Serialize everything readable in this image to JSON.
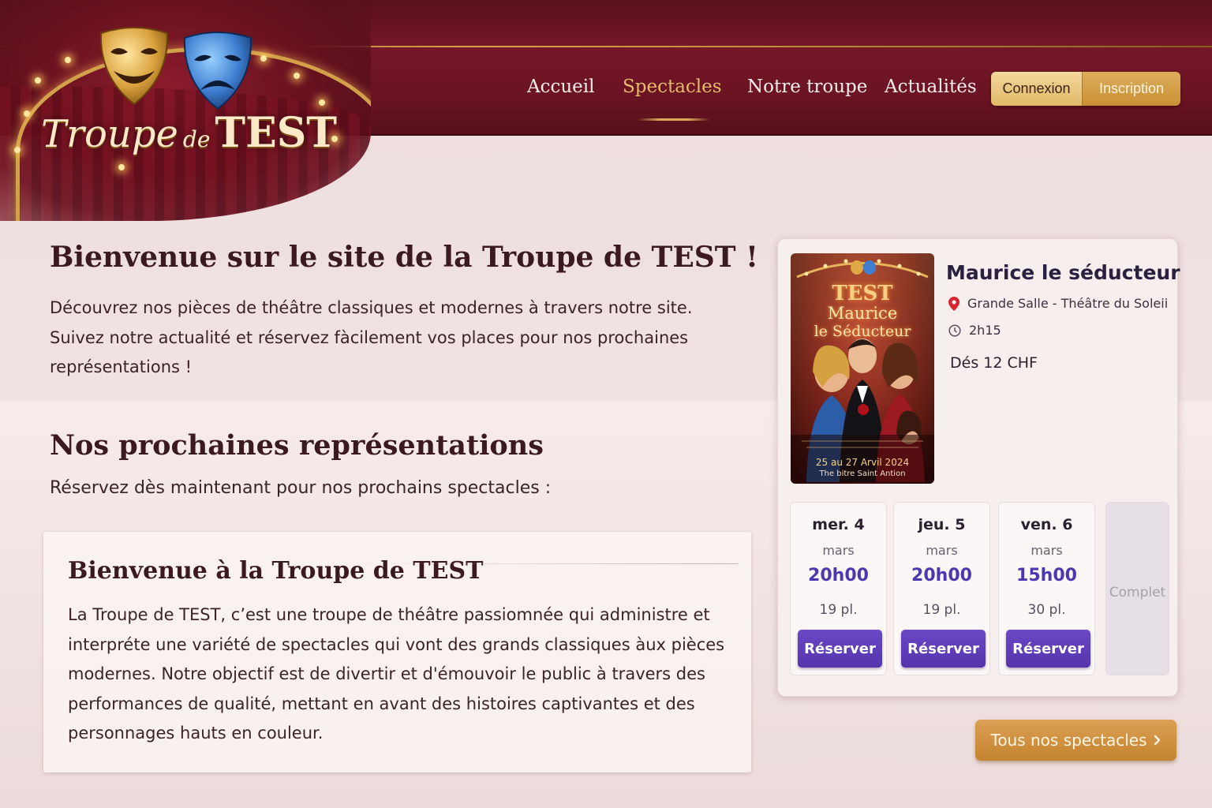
{
  "brand": {
    "name_part1": "Troupe",
    "name_part2": "de",
    "name_part3": "TEST"
  },
  "nav": {
    "items": [
      {
        "label": "Accueil",
        "active": false
      },
      {
        "label": "Spectacles",
        "active": true
      },
      {
        "label": "Notre troupe",
        "active": false
      },
      {
        "label": "Actualités",
        "active": false
      }
    ],
    "login": "Connexion",
    "signup": "Inscription"
  },
  "hero": {
    "title": "Bienvenue sur le site de la Troupe de TEST !",
    "intro": "Découvrez nos pièces de théâtre classiques et modernes à travers notre site. Suivez notre actualité et réservez fàcilement vos places pour nos prochaines représentations !"
  },
  "upcoming": {
    "title": "Nos prochaines représentations",
    "subtitle": "Réservez dès maintenant pour nos prochains spectacles :"
  },
  "about": {
    "title": "Bienvenue à la Troupe de TEST",
    "text": "La Troupe de TEST, c’est une troupe de théâtre passiomnée qui administre et interpréte une variété de spectacles qui vont des grands classiques àux pièces modernes. Notre objectif est de divertir et d'émouvoir le public à travers des performances de qualité, mettant en avant des histoires captivantes et des personnages hauts en couleur."
  },
  "show": {
    "title": "Maurice le séducteur",
    "location": "Grande Salle - Théâtre du Soleii",
    "duration": "2h15",
    "price": "Dés 12 CHF",
    "poster": {
      "top": "TEST",
      "title_line1": "Maurice",
      "title_line2": "le Séducteur",
      "dates": "25 au 27 Arvil 2024",
      "venue": "The bitre Saint Antion"
    },
    "dates": [
      {
        "day": "mer. 4",
        "month": "mars",
        "time": "20h00",
        "places": "19 pl.",
        "button": "Réserver"
      },
      {
        "day": "jeu. 5",
        "month": "mars",
        "time": "20h00",
        "places": "19 pl.",
        "button": "Réserver"
      },
      {
        "day": "ven. 6",
        "month": "mars",
        "time": "15h00",
        "places": "30 pl.",
        "button": "Réserver"
      }
    ],
    "full_label": "Complet"
  },
  "all_shows_button": "Tous nos spectacles",
  "colors": {
    "header": "#741728",
    "gold": "#d9a858",
    "reserve_button": "#5a38b2",
    "time_text": "#4b37b0"
  },
  "icons": [
    "comedy-mask-icon",
    "tragedy-mask-icon",
    "pin-icon",
    "clock-icon",
    "chevron-right-icon"
  ]
}
